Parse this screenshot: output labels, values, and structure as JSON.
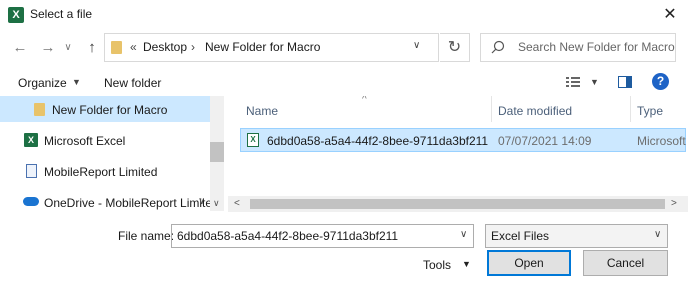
{
  "window": {
    "title": "Select a file",
    "app_icon": "X",
    "close_glyph": "✕"
  },
  "nav": {
    "back": "←",
    "forward": "→",
    "dropdown": "∨",
    "up": "↑"
  },
  "address": {
    "overflow": "«",
    "crumbs": [
      "Desktop",
      "New Folder for Macro"
    ],
    "separator": "›",
    "dropdown": "∨",
    "refresh": "↻"
  },
  "search": {
    "placeholder": "Search New Folder for Macro"
  },
  "toolbar": {
    "organize": "Organize",
    "new_folder": "New folder",
    "caret": "▼",
    "help": "?"
  },
  "sidebar": {
    "items": [
      {
        "label": "New Folder for Macro",
        "icon": "folder-icon",
        "selected": true
      },
      {
        "label": "Microsoft Excel",
        "icon": "excel-icon"
      },
      {
        "label": "MobileReport Limited",
        "icon": "document-icon"
      },
      {
        "label": "OneDrive - MobileReport Limite",
        "icon": "onedrive-icon",
        "expander": "∨"
      }
    ]
  },
  "file_list": {
    "columns": [
      "Name",
      "Date modified",
      "Type"
    ],
    "sort_glyph": "^",
    "rows": [
      {
        "name": "6dbd0a58-a5a4-44f2-8bee-9711da3bf211",
        "date_modified": "07/07/2021 14:09",
        "type": "Microsoft",
        "selected": true
      }
    ]
  },
  "scroll": {
    "left": "<",
    "right": ">",
    "down": "∨"
  },
  "footer": {
    "file_name_label": "File name:",
    "file_name_value": "6dbd0a58-a5a4-44f2-8bee-9711da3bf211",
    "file_type_value": "Excel Files",
    "dropdown": "∨",
    "tools_label": "Tools",
    "tools_caret": "▼",
    "open_label": "Open",
    "cancel_label": "Cancel"
  },
  "colors": {
    "selection": "#cce8ff",
    "selection_border": "#99d1ff",
    "excel_green": "#1d7044",
    "accent": "#0078d7"
  }
}
